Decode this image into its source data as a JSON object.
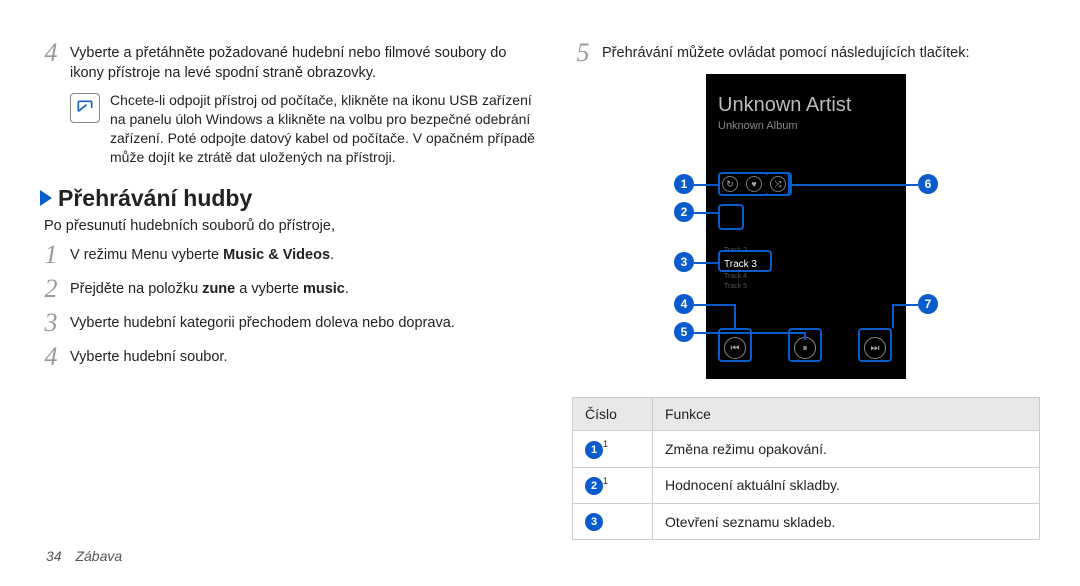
{
  "left": {
    "step4": "Vyberte a přetáhněte požadované hudební nebo filmové soubory do ikony přístroje na levé spodní straně obrazovky.",
    "note": "Chcete-li odpojit přístroj od počítače, klikněte na ikonu USB zařízení na panelu úloh Windows a klikněte na volbu pro bezpečné odebrání zařízení. Poté odpojte datový kabel od počítače. V opačném případě může dojít ke ztrátě dat uložených na přístroji.",
    "section_title": "Přehrávání hudby",
    "intro": "Po přesunutí hudebních souborů do přístroje,",
    "s1_a": "V režimu Menu vyberte ",
    "s1_b": "Music & Videos",
    "s1_c": ".",
    "s2_a": "Přejděte na položku ",
    "s2_b": "zune",
    "s2_c": " a vyberte ",
    "s2_d": "music",
    "s2_e": ".",
    "s3": "Vyberte hudební kategorii přechodem doleva nebo doprava.",
    "s4b": "Vyberte hudební soubor."
  },
  "right": {
    "step5": "Přehrávání můžete ovládat pomocí následujících tlačítek:",
    "artist": "Unknown Artist",
    "album": "Unknown Album",
    "track2": "Track 2",
    "track3": "Track 3",
    "track4": "Track 4",
    "track5": "Track 5",
    "th_cislo": "Číslo",
    "th_funkce": "Funkce",
    "row1": "Změna režimu opakování.",
    "row2": "Hodnocení aktuální skladby.",
    "row3": "Otevření seznamu skladeb."
  },
  "nums": {
    "n1": "1",
    "n2": "2",
    "n3": "3",
    "n4": "4",
    "n5": "5",
    "n6": "6",
    "n7": "7"
  },
  "footer": {
    "page": "34",
    "section": "Zábava"
  },
  "footnote": "1"
}
